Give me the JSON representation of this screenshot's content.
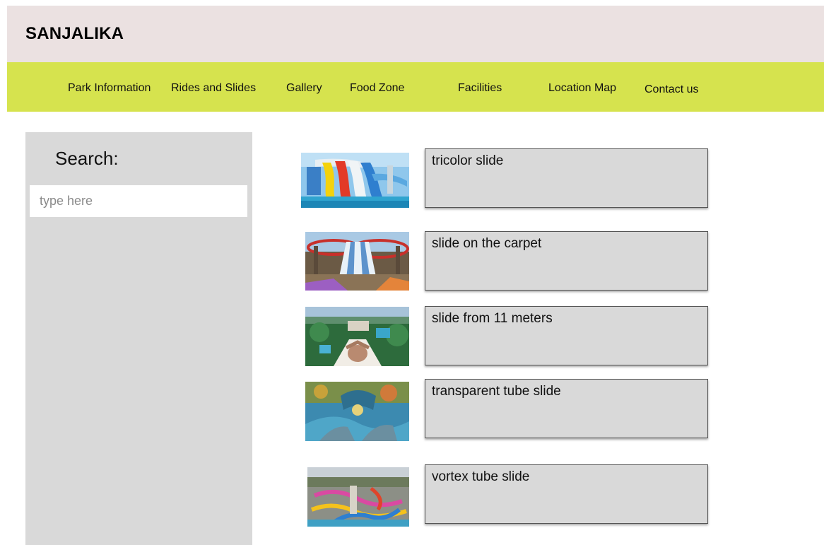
{
  "header": {
    "brand": "SANJALIKA"
  },
  "nav": {
    "items": [
      "Park Information",
      "Rides and Slides",
      "Gallery",
      "Food Zone",
      "Facilities",
      "Location Map",
      "Contact us"
    ]
  },
  "sidebar": {
    "search_label": "Search:",
    "search_placeholder": "type here"
  },
  "rides": [
    {
      "title": "tricolor slide"
    },
    {
      "title": "slide on the carpet"
    },
    {
      "title": "slide from 11 meters"
    },
    {
      "title": "transparent tube slide"
    },
    {
      "title": "vortex tube slide"
    }
  ],
  "colors": {
    "header_bg": "#ebe1e1",
    "nav_bg": "#d6e34e",
    "panel_gray": "#d9d9d9"
  }
}
